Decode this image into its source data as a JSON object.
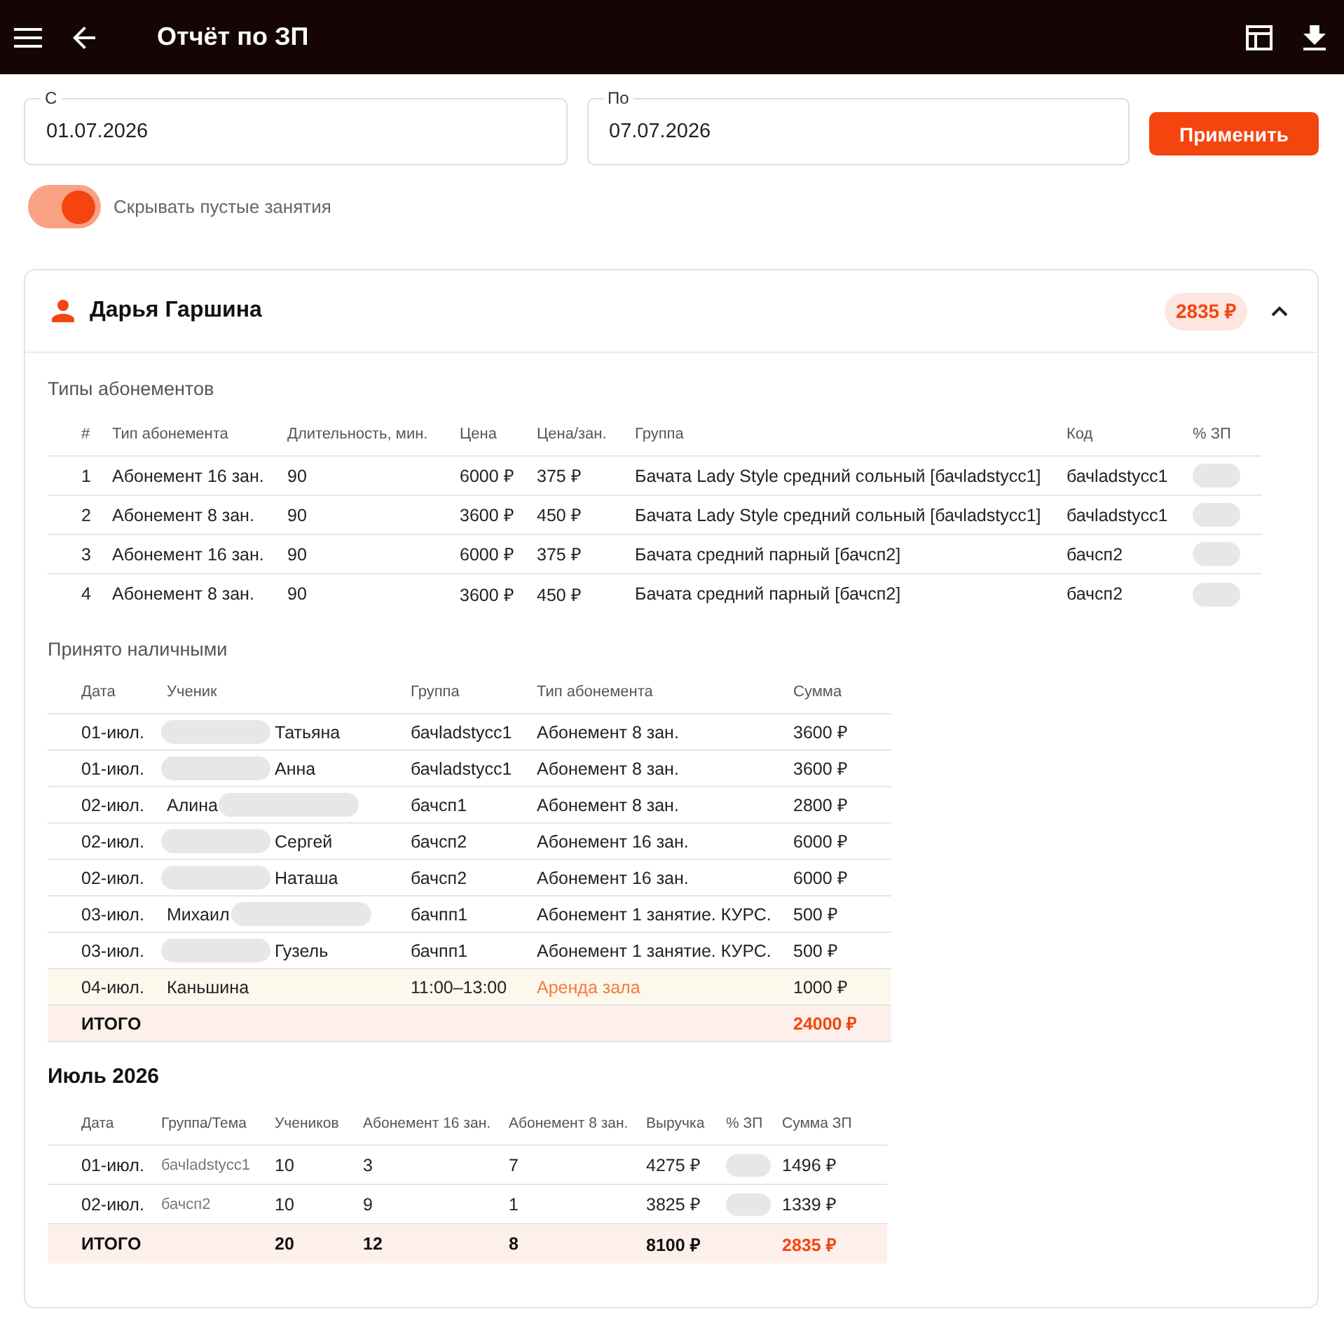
{
  "app_bar": {
    "title": "Отчёт по ЗП"
  },
  "filters": {
    "fields": [
      {
        "label": "С",
        "value": "01.07.2026"
      },
      {
        "label": "По",
        "value": "07.07.2026"
      }
    ],
    "apply_button": "Применить",
    "toggle": {
      "label": "Скрывать пустые занятия",
      "on": true
    }
  },
  "employee": {
    "name": "Дарья Гаршина",
    "total_badge": "2835 ₽",
    "expanded": true,
    "subscription_types": {
      "title": "Типы абонементов",
      "columns": [
        "#",
        "Тип абонемента",
        "Длительность, мин.",
        "Цена",
        "Цена/зан.",
        "Группа",
        "Код",
        "% ЗП"
      ],
      "rows": [
        {
          "num": "1",
          "type": "Абонемент 16 зан.",
          "duration": "90",
          "price": "6000 ₽",
          "per_lesson": "375 ₽",
          "group": "Бачата Lady Style средний сольный [бачladstycc1]",
          "code": "бачladstycc1",
          "pct_masked": true
        },
        {
          "num": "2",
          "type": "Абонемент 8 зан.",
          "duration": "90",
          "price": "3600 ₽",
          "per_lesson": "450 ₽",
          "group": "Бачата Lady Style средний сольный [бачladstycc1]",
          "code": "бачladstycc1",
          "pct_masked": true
        },
        {
          "num": "3",
          "type": "Абонемент 16 зан.",
          "duration": "90",
          "price": "6000 ₽",
          "per_lesson": "375 ₽",
          "group": "Бачата средний парный [бачсп2]",
          "code": "бачсп2",
          "pct_masked": true
        },
        {
          "num": "4",
          "type": "Абонемент 8 зан.",
          "duration": "90",
          "price": "3600 ₽",
          "per_lesson": "450 ₽",
          "group": "Бачата средний парный [бачсп2]",
          "code": "бачсп2",
          "pct_masked": true
        }
      ]
    },
    "cash": {
      "title": "Принято наличными",
      "columns": [
        "Дата",
        "Ученик",
        "Группа",
        "Тип абонемента",
        "Сумма"
      ],
      "rows": [
        {
          "kind": "payment",
          "date": "01-июл.",
          "student": [
            {
              "kind": "smudge"
            },
            {
              "kind": "name",
              "text": "Татьяна"
            }
          ],
          "group": "бачladstycc1",
          "type": "Абонемент 8 зан.",
          "sum": "3600 ₽"
        },
        {
          "kind": "payment",
          "date": "01-июл.",
          "student": [
            {
              "kind": "smudge"
            },
            {
              "kind": "name",
              "text": "Анна"
            }
          ],
          "group": "бачladstycc1",
          "type": "Абонемент 8 зан.",
          "sum": "3600 ₽"
        },
        {
          "kind": "payment",
          "date": "02-июл.",
          "student": [
            {
              "kind": "name",
              "text": "Алина"
            },
            {
              "kind": "smudge"
            }
          ],
          "group": "бачсп1",
          "type": "Абонемент 8 зан.",
          "sum": "2800 ₽"
        },
        {
          "kind": "payment",
          "date": "02-июл.",
          "student": [
            {
              "kind": "smudge"
            },
            {
              "kind": "name",
              "text": "Сергей"
            }
          ],
          "group": "бачсп2",
          "type": "Абонемент 16 зан.",
          "sum": "6000 ₽"
        },
        {
          "kind": "payment",
          "date": "02-июл.",
          "student": [
            {
              "kind": "smudge"
            },
            {
              "kind": "name",
              "text": "Наташа"
            }
          ],
          "group": "бачсп2",
          "type": "Абонемент 16 зан.",
          "sum": "6000 ₽"
        },
        {
          "kind": "payment",
          "date": "03-июл.",
          "student": [
            {
              "kind": "name",
              "text": "Михаил"
            },
            {
              "kind": "smudge"
            }
          ],
          "group": "бачпп1",
          "type": "Абонемент 1 занятие. КУРС.",
          "sum": "500 ₽"
        },
        {
          "kind": "payment",
          "date": "03-июл.",
          "student": [
            {
              "kind": "smudge"
            },
            {
              "kind": "name",
              "text": "Гузель"
            }
          ],
          "group": "бачпп1",
          "type": "Абонемент 1 занятие. КУРС.",
          "sum": "500 ₽"
        },
        {
          "kind": "rental",
          "date": "04-июл.",
          "student": [
            {
              "kind": "name",
              "text": "Каньшина"
            }
          ],
          "group": "11:00–13:00",
          "type": "Аренда зала",
          "sum": "1000 ₽"
        },
        {
          "kind": "total",
          "date": "ИТОГО",
          "sum": "24000 ₽"
        }
      ]
    },
    "month": {
      "title": "Июль 2026",
      "columns": [
        "Дата",
        "Группа/Тема",
        "Учеников",
        "Абонемент 16 зан.",
        "Абонемент 8 зан.",
        "Выручка",
        "% ЗП",
        "Сумма ЗП"
      ],
      "rows": [
        {
          "kind": "day",
          "date": "01-июл.",
          "group": "бачladstycc1",
          "students": "10",
          "sub16": "3",
          "sub8": "7",
          "revenue": "4275 ₽",
          "pct_masked": true,
          "salary": "1496 ₽"
        },
        {
          "kind": "day",
          "date": "02-июл.",
          "group": "бачсп2",
          "students": "10",
          "sub16": "9",
          "sub8": "1",
          "revenue": "3825 ₽",
          "pct_masked": true,
          "salary": "1339 ₽"
        },
        {
          "kind": "total",
          "date": "ИТОГО",
          "students": "20",
          "sub16": "12",
          "sub8": "8",
          "revenue": "8100 ₽",
          "salary": "2835 ₽"
        }
      ]
    }
  }
}
